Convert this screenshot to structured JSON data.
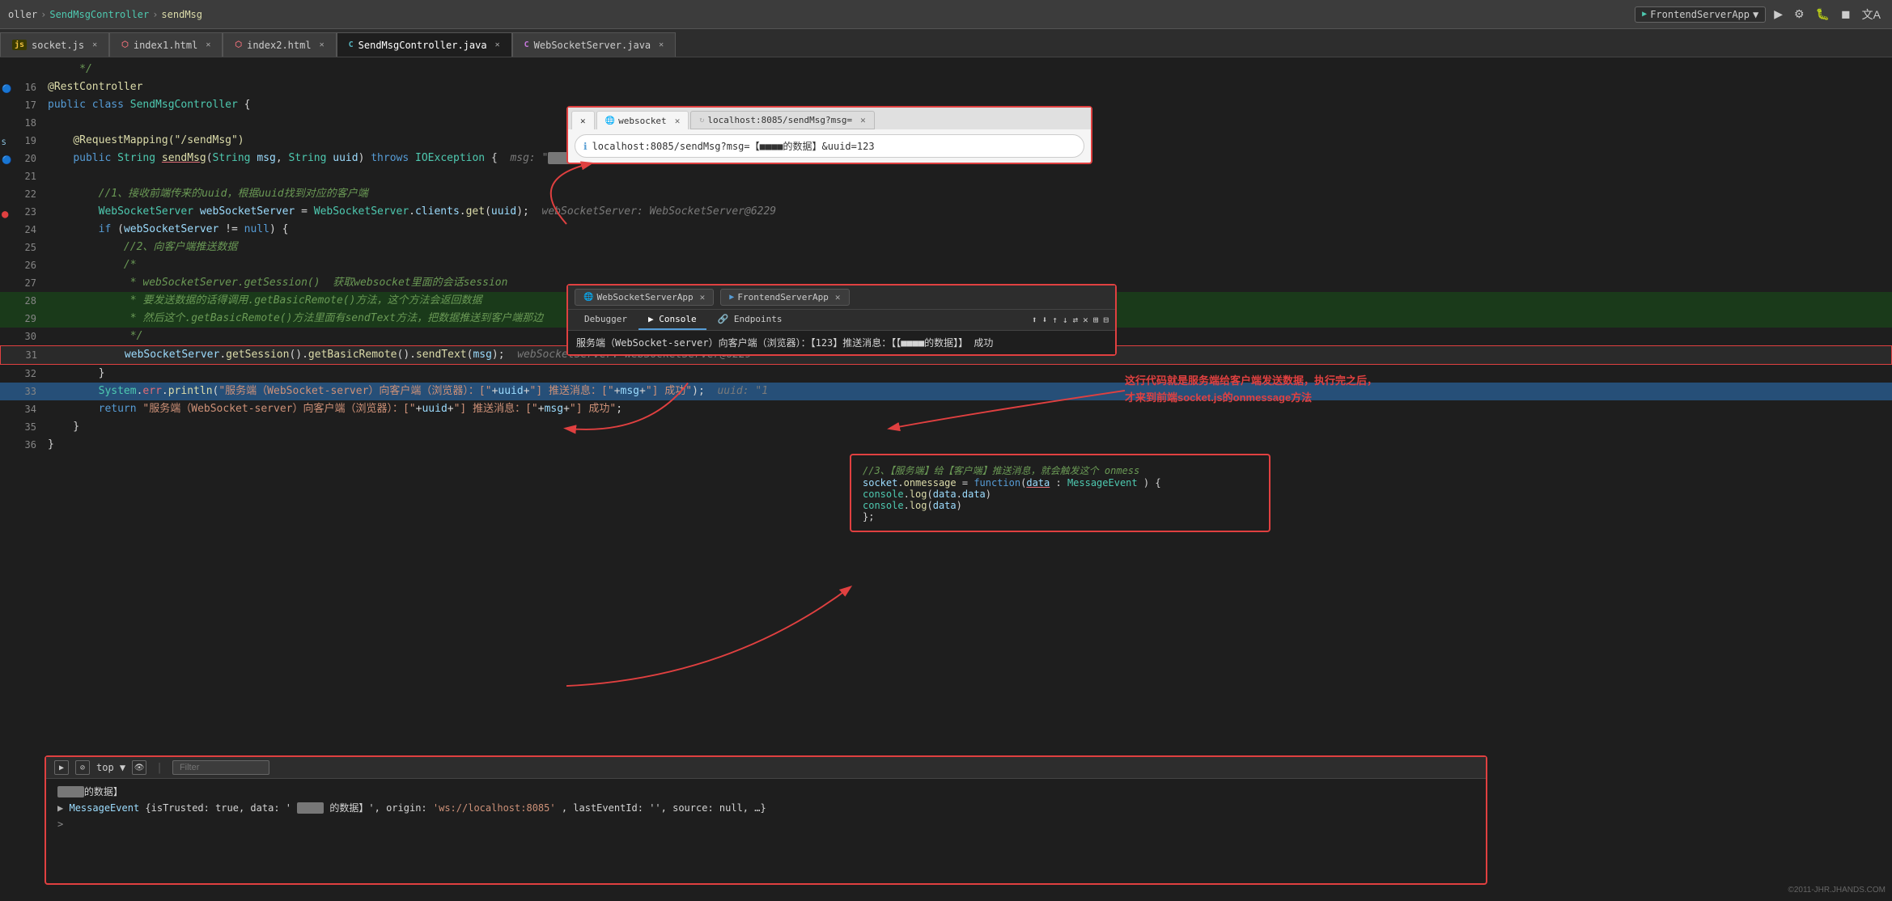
{
  "toolbar": {
    "breadcrumb": [
      "oller",
      "SendMsgController",
      "sendMsg"
    ],
    "app_selector": "FrontendServerApp",
    "buttons": [
      "▶",
      "⚙",
      "↻",
      "◼",
      "📁",
      "文",
      "⬜"
    ]
  },
  "tabs": [
    {
      "id": "socket-js",
      "label": "socket.js",
      "type": "js",
      "active": false
    },
    {
      "id": "index1-html",
      "label": "index1.html",
      "type": "html",
      "active": false
    },
    {
      "id": "index2-html",
      "label": "index2.html",
      "type": "html",
      "active": false
    },
    {
      "id": "sendmsg-controller",
      "label": "SendMsgController.java",
      "type": "java",
      "active": true
    },
    {
      "id": "websocket-server",
      "label": "WebSocketServer.java",
      "type": "java2",
      "active": false
    }
  ],
  "code_lines": [
    {
      "num": 16,
      "content": "    @RestController",
      "type": "annotation"
    },
    {
      "num": 17,
      "content": "    public class SendMsgController {"
    },
    {
      "num": 18,
      "content": ""
    },
    {
      "num": 19,
      "content": "        @RequestMapping(\"/sendMsg\")",
      "type": "annotation"
    },
    {
      "num": 20,
      "content": "        public String sendMsg(String msg, String uuid) throws IOException {  msg: \"■■■■的数据\" uuid: \"123\"",
      "highlight": false
    },
    {
      "num": 21,
      "content": ""
    },
    {
      "num": 22,
      "content": "            //1、接收前端传来的uuid，根据uuid找到对应的客户端",
      "type": "comment"
    },
    {
      "num": 23,
      "content": "            WebSocketServer webSocketServer = WebSocketServer.clients.get(uuid);  webSocketServer: WebSocketServer@6229",
      "type": "bp"
    },
    {
      "num": 24,
      "content": "            if (webSocketServer != null) {"
    },
    {
      "num": 25,
      "content": "                //2、向客户端推送数据",
      "type": "comment"
    },
    {
      "num": 26,
      "content": "                /*",
      "type": "comment"
    },
    {
      "num": 27,
      "content": "                 * webSocketServer.getSession() 获取websocket里面的会话session",
      "type": "comment"
    },
    {
      "num": 28,
      "content": "                 * 要发送数据的话得调用.getBasicRemote()方法，这个方法会返回数据",
      "type": "comment",
      "green": true
    },
    {
      "num": 29,
      "content": "                 * 然后这个.getBasicRemote()方法里面有sendText方法，把数据推送到客户端那边",
      "type": "comment",
      "green": true
    },
    {
      "num": 30,
      "content": "                 */",
      "type": "comment"
    },
    {
      "num": 31,
      "content": "                webSocketServer.getSession().getBasicRemote().sendText(msg);   webSocketServer: WebSocketServer@6229",
      "boxed": true
    },
    {
      "num": 32,
      "content": "            }"
    },
    {
      "num": 33,
      "content": "            System.err.println(\"服务端（WebSocket-server）向客户端（浏览器）：[\"+uuid+\"] 推送消息：[\"+msg+\"] 成功\");  uuid: \"1",
      "highlighted": true
    },
    {
      "num": 34,
      "content": "            return \"服务端（WebSocket-server）向客户端（浏览器）：[\"+uuid+\"] 推送消息：[\"+msg+\"] 成功\";"
    },
    {
      "num": 35,
      "content": "        }"
    },
    {
      "num": 36,
      "content": "    }"
    }
  ],
  "browser_overlay": {
    "tab1_label": "websocket",
    "tab2_label": "localhost:8085/sendMsg?msg=",
    "url": "localhost:8085/sendMsg?msg=【■■■■的数据】&uuid=123"
  },
  "console_overlay": {
    "app1": "WebSocketServerApp",
    "app2": "FrontendServerApp",
    "tabs": [
      "Debugger",
      "Console",
      "Endpoints"
    ],
    "active_tab": "Console",
    "message": "服务端（WebSocket-server）向客户端（浏览器）：【123】推送消息：【【■■■■的数据】】 成功"
  },
  "bottom_panel": {
    "buttons": [
      "▶",
      "⊘",
      "top",
      "▼",
      "👁",
      "|",
      "Filter"
    ],
    "logs": [
      "■■■■的数据】",
      "▶MessageEvent {isTrusted: true, data: '■■■■的数据】', origin: 'ws://localhost:8085', lastEventId: '', source: null, …}",
      ">"
    ]
  },
  "right_comment": {
    "line1": "这行代码就是服务端给客户端发送数据，执行完之后，",
    "line2": "才来到前端socket.js的onmessage方法"
  },
  "right_code_box": {
    "line1": "//3、【服务端】给【客户端】推送消息，就会触发这个 onmess",
    "line2": "socket.onmessage = function(data : MessageEvent ) {",
    "line3": "",
    "line4": "    console.log(data.data)",
    "line5": "    console.log(data)",
    "line6": "",
    "line7": "};"
  },
  "watermark": "©2011-JHR.JHANDS.COM"
}
